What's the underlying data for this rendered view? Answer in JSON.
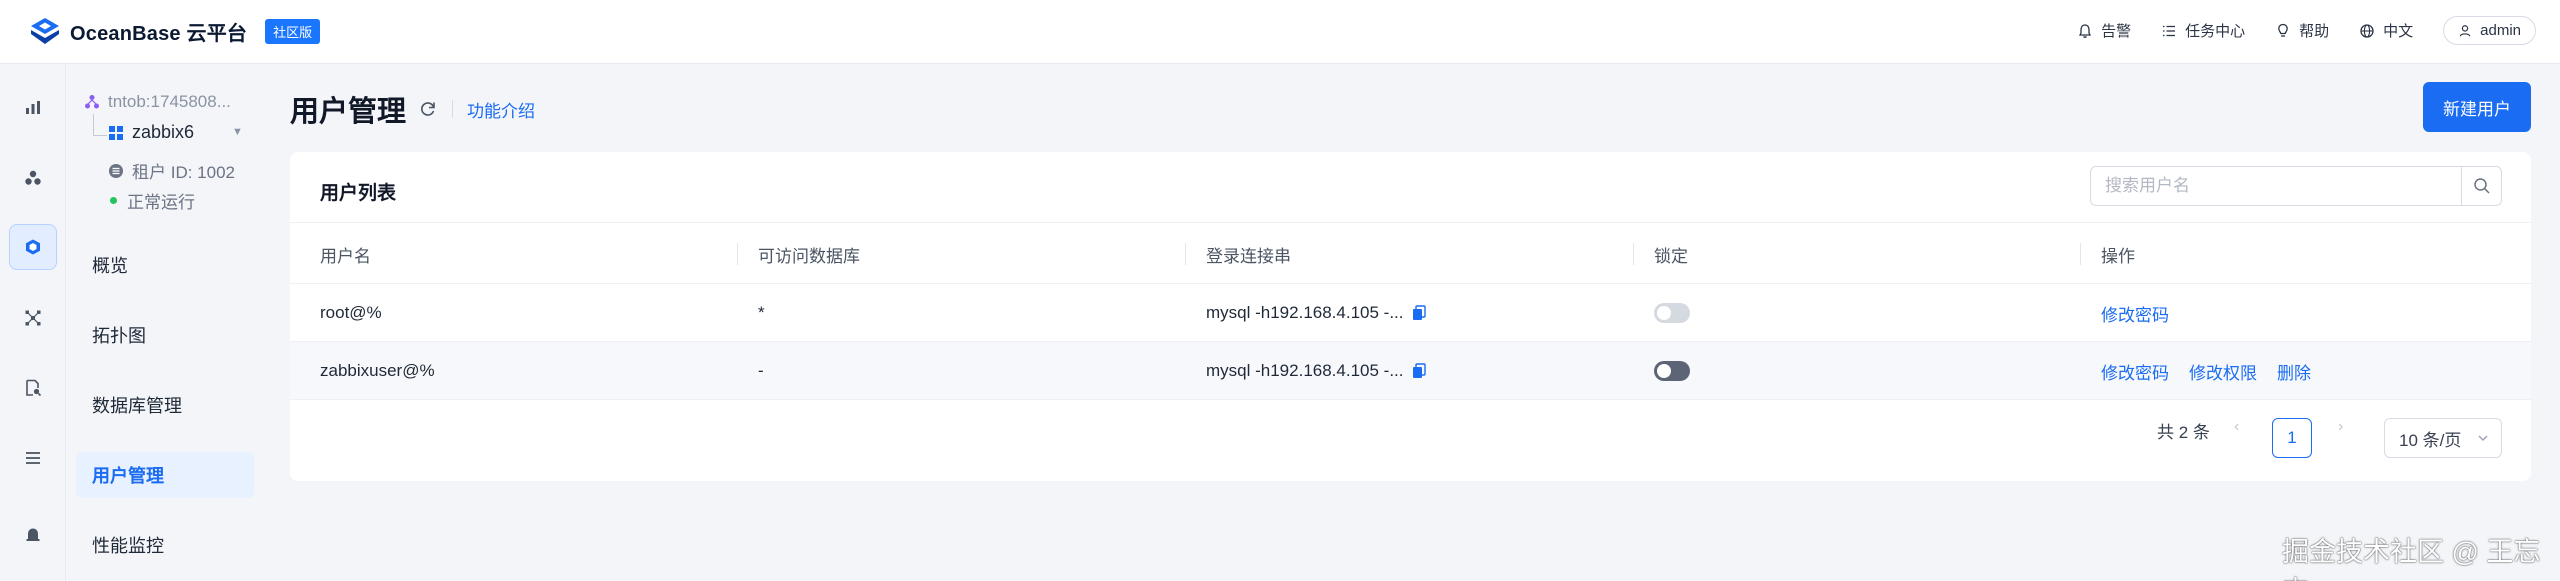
{
  "brand": {
    "name": "OceanBase 云平台",
    "edition": "社区版",
    "accent": "#1a6cf2"
  },
  "top_actions": {
    "alerts": "告警",
    "tasks": "任务中心",
    "help": "帮助",
    "language": "中文",
    "user": "admin"
  },
  "context": {
    "tenant": "tntob:1745808...",
    "cluster": "zabbix6",
    "tenant_id": "租户 ID: 1002",
    "status": "正常运行"
  },
  "nav": {
    "items": [
      {
        "label": "概览"
      },
      {
        "label": "拓扑图"
      },
      {
        "label": "数据库管理"
      },
      {
        "label": "用户管理"
      },
      {
        "label": "性能监控"
      }
    ]
  },
  "page": {
    "title": "用户管理",
    "intro_link": "功能介绍",
    "new_user_button": "新建用户"
  },
  "user_list": {
    "title": "用户列表",
    "search_placeholder": "搜索用户名",
    "columns": [
      "用户名",
      "可访问数据库",
      "登录连接串",
      "锁定",
      "操作"
    ],
    "rows": [
      {
        "username": "root@%",
        "databases": "*",
        "connection": "mysql -h192.168.4.105 -...",
        "locked": false,
        "actions": [
          "修改密码"
        ]
      },
      {
        "username": "zabbixuser@%",
        "databases": "-",
        "connection": "mysql -h192.168.4.105 -...",
        "locked": true,
        "actions": [
          "修改密码",
          "修改权限",
          "删除"
        ]
      }
    ]
  },
  "pagination": {
    "total": "共 2 条",
    "current_page": "1",
    "page_size": "10 条/页"
  },
  "watermark": "掘金技术社区 @ 王忘杰"
}
